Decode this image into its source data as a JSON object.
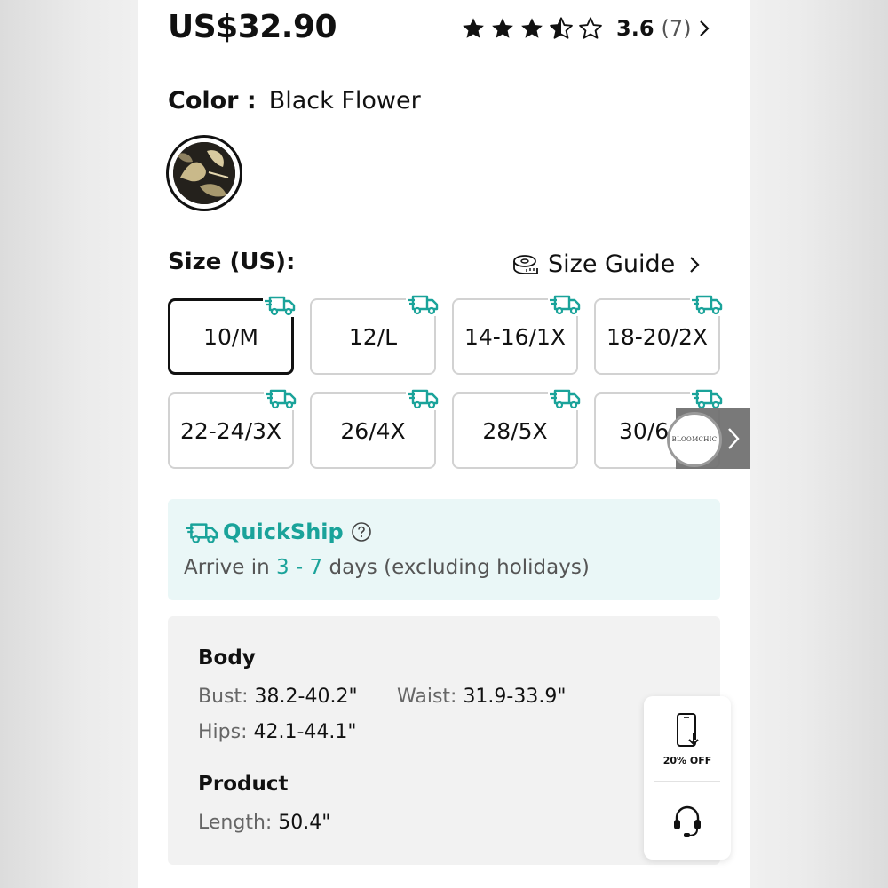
{
  "product": {
    "price": "US$32.90",
    "rating": {
      "stars": 3.5,
      "value": "3.6",
      "count": "(7)"
    }
  },
  "color": {
    "label": "Color :",
    "value": "Black Flower"
  },
  "size": {
    "label": "Size (US):",
    "guide_label": "Size Guide",
    "options": [
      "10/M",
      "12/L",
      "14-16/1X",
      "18-20/2X",
      "22-24/3X",
      "26/4X",
      "28/5X",
      "30/6"
    ],
    "selected": "10/M"
  },
  "brand": {
    "logo_text": "BLOOMCHIC"
  },
  "quickship": {
    "title": "QuickShip",
    "arrive_prefix": "Arrive in ",
    "arrive_range": "3 - 7",
    "arrive_suffix": " days (excluding holidays)"
  },
  "details": {
    "body_heading": "Body",
    "bust_label": "Bust: ",
    "bust_value": "38.2-40.2\"",
    "waist_label": "Waist: ",
    "waist_value": "31.9-33.9\"",
    "hips_label": "Hips: ",
    "hips_value": "42.1-44.1\"",
    "product_heading": "Product",
    "length_label": "Length: ",
    "length_value": "50.4\""
  },
  "floating": {
    "app_discount": "20% OFF"
  },
  "colors": {
    "accent_teal": "#1aa39a",
    "quickship_bg": "#eaf7f7"
  },
  "icons": [
    "star-icon",
    "half-star-icon",
    "chevron-right-icon",
    "tape-measure-icon",
    "truck-icon",
    "help-icon",
    "phone-download-icon",
    "headset-icon"
  ]
}
